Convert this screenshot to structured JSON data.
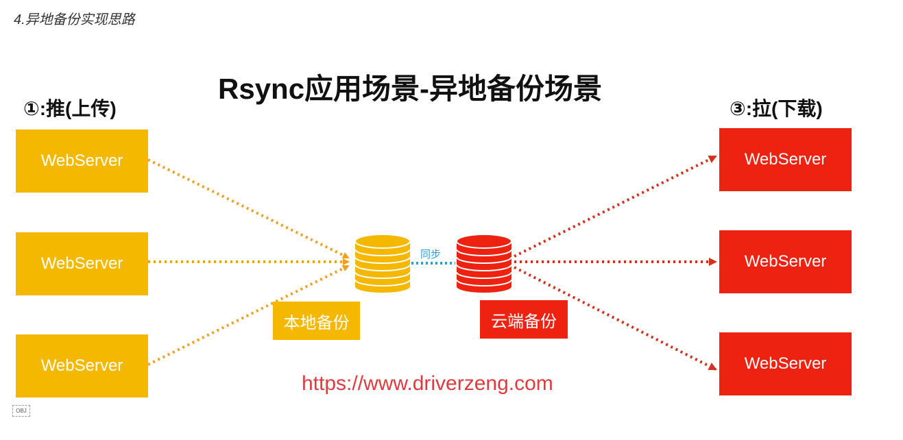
{
  "heading": "4.异地备份实现思路",
  "title": "Rsync应用场景-异地备份场景",
  "push_label": "①:推(上传)",
  "pull_label": "③:拉(下载)",
  "left_servers": [
    "WebServer",
    "WebServer",
    "WebServer"
  ],
  "right_servers": [
    "WebServer",
    "WebServer",
    "WebServer"
  ],
  "local_backup": "本地备份",
  "cloud_backup": "云端备份",
  "sync_label": "同步",
  "url": "https://www.driverzeng.com",
  "obj_marker": "OBJ",
  "colors": {
    "local": "#F5B800",
    "cloud": "#EE2211",
    "sync": "#2A9FD8",
    "url": "#E03A3E",
    "push_line": "#F0A020",
    "pull_line": "#D4301E"
  }
}
